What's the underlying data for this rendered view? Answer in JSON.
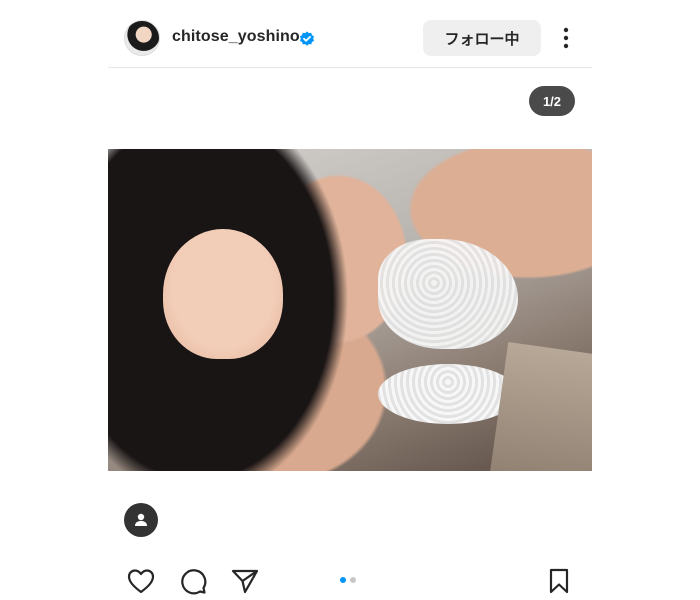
{
  "header": {
    "username": "chitose_yoshino",
    "follow_label": "フォロー中",
    "verified_icon": "verified-badge-icon",
    "more_icon": "more-vertical-icon"
  },
  "carousel": {
    "counter": "1/2",
    "current": 1,
    "total": 2
  },
  "icons": {
    "profile_tag": "person-icon",
    "like": "heart-icon",
    "comment": "comment-icon",
    "share": "send-icon",
    "save": "bookmark-icon"
  },
  "colors": {
    "accent": "#0095f6",
    "button_bg": "#efefef",
    "text": "#262626",
    "counter_bg": "#4a4a4a"
  }
}
